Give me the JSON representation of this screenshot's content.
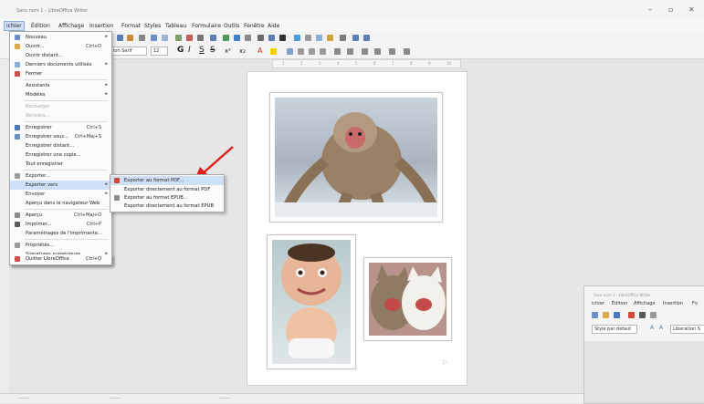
{
  "window": {
    "title": "Sans nom 1 - LibreOffice Writer",
    "controls": [
      "minimize-icon",
      "maximize-icon",
      "close-icon"
    ]
  },
  "menubar": {
    "items": [
      "Fichier",
      "Édition",
      "Affichage",
      "Insertion",
      "Format",
      "Styles",
      "Tableau",
      "Formulaire",
      "Outils",
      "Fenêtre",
      "Aide"
    ],
    "active": "Fichier",
    "visible_labels": [
      "ichier",
      "Édition",
      "Affichage",
      "Insertion",
      "Format",
      "Styles",
      "Tableau",
      "Formulaire",
      "Outils",
      "Fenêtre",
      "Aide"
    ]
  },
  "toolbar": {
    "font_name": "ion Serif",
    "font_size": "12",
    "bold": "G",
    "italic": "I",
    "underline": "S",
    "strike": "S"
  },
  "file_menu": {
    "items": [
      {
        "label": "Nouveau",
        "shortcut": "",
        "submenu": true,
        "icon": "new-doc-icon"
      },
      {
        "label": "Ouvrir...",
        "shortcut": "Ctrl+O",
        "icon": "open-folder-icon"
      },
      {
        "label": "Ouvrir distant...",
        "shortcut": ""
      },
      {
        "label": "Derniers documents utilisés",
        "shortcut": "",
        "submenu": true,
        "icon": "recent-docs-icon"
      },
      {
        "label": "Fermer",
        "shortcut": "",
        "icon": "close-doc-icon"
      },
      {
        "label": "Assistants",
        "shortcut": "",
        "submenu": true
      },
      {
        "label": "Modèles",
        "shortcut": "",
        "submenu": true
      },
      {
        "label": "Recharger",
        "shortcut": "",
        "disabled": true
      },
      {
        "label": "Versions...",
        "shortcut": "",
        "disabled": true
      },
      {
        "label": "Enregistrer",
        "shortcut": "Ctrl+S",
        "icon": "save-icon"
      },
      {
        "label": "Enregistrer sous...",
        "shortcut": "Ctrl+Maj+S",
        "icon": "save-as-icon"
      },
      {
        "label": "Enregistrer distant...",
        "shortcut": ""
      },
      {
        "label": "Enregistrer une copie...",
        "shortcut": ""
      },
      {
        "label": "Tout enregistrer",
        "shortcut": ""
      },
      {
        "label": "Exporter...",
        "shortcut": "",
        "icon": "export-icon"
      },
      {
        "label": "Exporter vers",
        "shortcut": "",
        "submenu": true,
        "highlighted": true
      },
      {
        "label": "Envoyer",
        "shortcut": "",
        "submenu": true
      },
      {
        "label": "Aperçu dans le navigateur Web",
        "shortcut": ""
      },
      {
        "label": "Aperçu",
        "shortcut": "Ctrl+Maj+O",
        "icon": "preview-icon"
      },
      {
        "label": "Imprimer...",
        "shortcut": "Ctrl+P",
        "icon": "print-icon"
      },
      {
        "label": "Paramétrages de l'imprimante...",
        "shortcut": ""
      },
      {
        "label": "Propriétés...",
        "shortcut": "",
        "icon": "properties-icon"
      },
      {
        "label": "Signatures numériques",
        "shortcut": "",
        "submenu": true
      },
      {
        "label": "Quitter LibreOffice",
        "shortcut": "Ctrl+Q",
        "icon": "quit-icon"
      }
    ]
  },
  "export_submenu": {
    "items": [
      {
        "label": "Exporter au format PDF...",
        "icon": "pdf-icon",
        "highlighted": true
      },
      {
        "label": "Exporter directement au format PDF",
        "icon": ""
      },
      {
        "label": "Exporter au format EPUB...",
        "icon": "epub-icon"
      },
      {
        "label": "Exporter directement au format EPUB",
        "icon": ""
      }
    ]
  },
  "annotation": {
    "arrow_color": "#e02020"
  },
  "document": {
    "images": [
      "snow-monkey-photo",
      "baby-caricature-photo",
      "laughing-cats-photo"
    ]
  },
  "second_window": {
    "title": "Sans nom 1 - LibreOffice Writer",
    "menu": [
      "ichier",
      "Édition",
      "Affichage",
      "Insertion",
      "Fo"
    ],
    "style_value": "Style par défaut",
    "font_value": "Liberation S"
  },
  "colors": {
    "highlight": "#cde0f7",
    "menu_bg": "#fbfbfb",
    "app_bg": "#e6e6e6"
  }
}
